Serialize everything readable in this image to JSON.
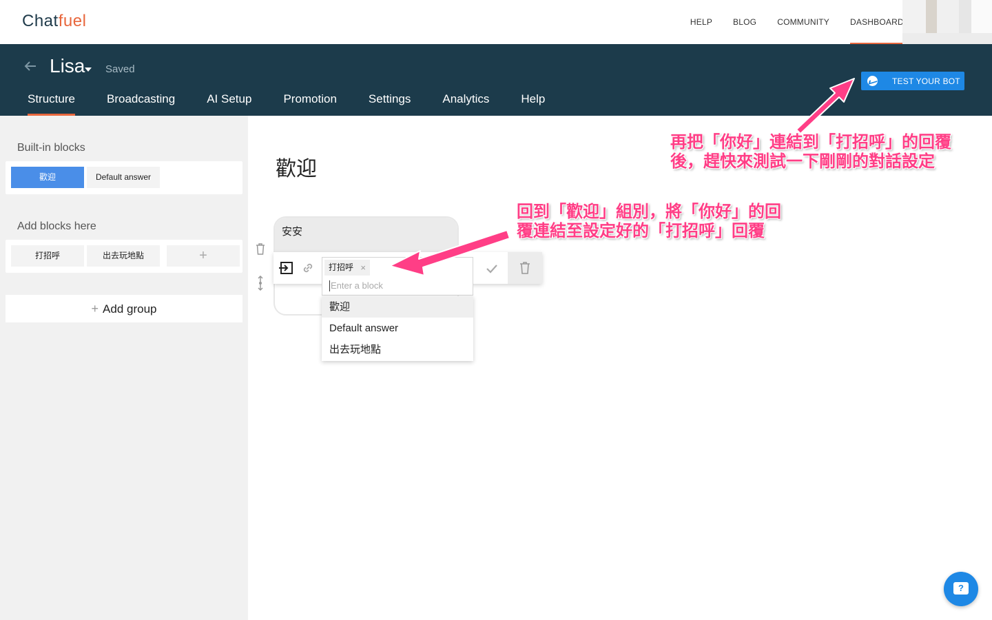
{
  "logo": {
    "part1": "Chat",
    "part2": "fuel"
  },
  "topnav": {
    "items": [
      "HELP",
      "BLOG",
      "COMMUNITY",
      "DASHBOARD"
    ]
  },
  "bot": {
    "name": "Lisa",
    "status": "Saved"
  },
  "tabs": [
    "Structure",
    "Broadcasting",
    "AI Setup",
    "Promotion",
    "Settings",
    "Analytics",
    "Help"
  ],
  "test_button": {
    "label": "TEST YOUR BOT"
  },
  "sidebar": {
    "builtin_title": "Built-in blocks",
    "builtin_blocks": [
      "歡迎",
      "Default answer"
    ],
    "add_title": "Add blocks here",
    "custom_blocks": [
      "打招呼",
      "出去玩地點"
    ],
    "add_block_symbol": "+",
    "add_group_symbol": "+",
    "add_group_label": "Add group"
  },
  "main": {
    "block_title": "歡迎",
    "bubble_text": "安安",
    "selected_tag": "打招呼",
    "tag_remove": "×",
    "input_placeholder": "Enter a block",
    "dropdown_options": [
      "歡迎",
      "Default answer",
      "出去玩地點"
    ]
  },
  "annotations": {
    "top": "再把「你好」連結到「打招呼」的回覆\n後，趕快來測試一下剛剛的對話設定",
    "middle": "回到「歡迎」組別，將「你好」的回\n覆連結至設定好的「打招呼」回覆"
  },
  "help_fab": {
    "icon_text": "?"
  },
  "colors": {
    "brand_dark": "#1c3b4b",
    "accent": "#e8673d",
    "primary": "#1e88e5",
    "annotation": "#ff3e86"
  }
}
